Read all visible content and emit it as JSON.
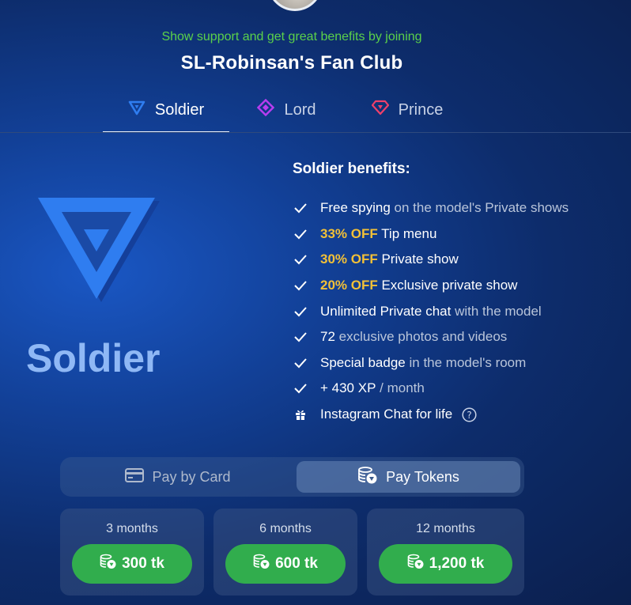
{
  "header": {
    "subtitle": "Show support and get great benefits by joining",
    "title": "SL-Robinsan's Fan Club"
  },
  "tabs": [
    {
      "label": "Soldier",
      "icon": "triangle-icon",
      "color": "#2f7df0",
      "active": true
    },
    {
      "label": "Lord",
      "icon": "diamond-icon",
      "color": "#b83df0",
      "active": false
    },
    {
      "label": "Prince",
      "icon": "gem-icon",
      "color": "#f0406a",
      "active": false
    }
  ],
  "tier": {
    "name": "Soldier",
    "emblem_color": "#2f7df0",
    "benefits_title": "Soldier benefits:",
    "benefits": [
      {
        "strong": "Free spying",
        "rest": " on the model's Private shows",
        "icon": "check-icon"
      },
      {
        "highlight": "33% OFF",
        "strong": " Tip menu",
        "icon": "check-icon"
      },
      {
        "highlight": "30% OFF",
        "strong": " Private show",
        "icon": "check-icon"
      },
      {
        "highlight": "20% OFF",
        "strong": " Exclusive private show",
        "icon": "check-icon"
      },
      {
        "strong": "Unlimited Private chat",
        "rest": " with the model",
        "icon": "check-icon"
      },
      {
        "strong": "72",
        "rest": " exclusive photos and videos",
        "icon": "check-icon"
      },
      {
        "strong": "Special badge",
        "rest": " in the model's room",
        "icon": "check-icon"
      },
      {
        "strong": "+ 430 XP",
        "rest": " / month",
        "icon": "check-icon"
      },
      {
        "strong": "Instagram Chat for life",
        "icon": "gift-icon",
        "help": true
      }
    ]
  },
  "payment": {
    "card_label": "Pay by Card",
    "tokens_label": "Pay Tokens",
    "selected": "tokens"
  },
  "plans": [
    {
      "months": "3 months",
      "price": "300 tk"
    },
    {
      "months": "6 months",
      "price": "600 tk"
    },
    {
      "months": "12 months",
      "price": "1,200 tk"
    }
  ],
  "colors": {
    "accent_green": "#31ad4d",
    "highlight_gold": "#f2c037",
    "subtitle_green": "#5bd14a"
  }
}
